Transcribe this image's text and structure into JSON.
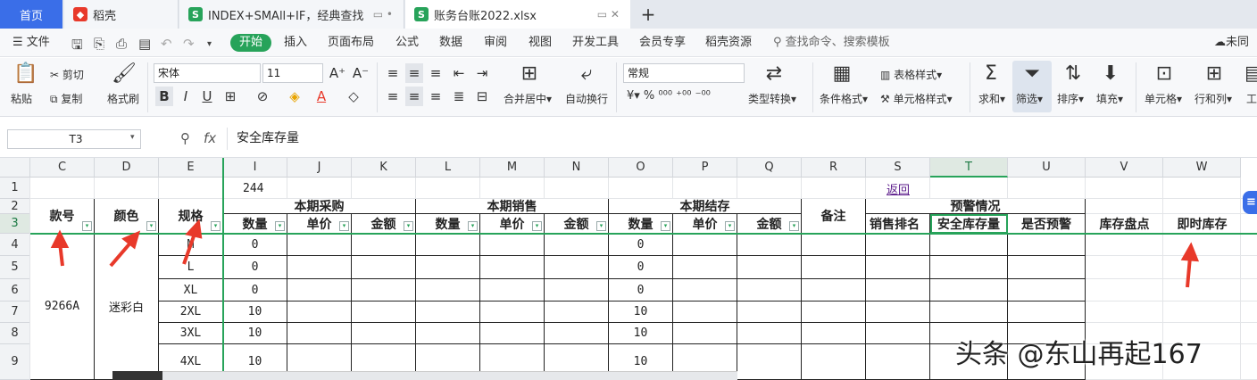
{
  "tabs": {
    "home": "首页",
    "shell": "稻壳",
    "file1": "INDEX+SMAll+IF，经典查找",
    "file2": "账务台账2022.xlsx",
    "add": "+"
  },
  "menu": {
    "file": "文件",
    "start": "开始",
    "insert": "插入",
    "layout": "页面布局",
    "formula": "公式",
    "data": "数据",
    "review": "审阅",
    "view": "视图",
    "dev": "开发工具",
    "vip": "会员专享",
    "resource": "稻壳资源",
    "search": "查找命令、搜索模板",
    "sync": "未同步"
  },
  "ribbon": {
    "paste": "粘贴",
    "cut": "剪切",
    "copy": "复制",
    "format_painter": "格式刷",
    "font_name": "宋体",
    "font_size": "11",
    "number_format": "常规",
    "merge": "合并居中",
    "wrap": "自动换行",
    "type_convert": "类型转换",
    "cond_format": "条件格式",
    "table_style": "表格样式",
    "cell_style": "单元格样式",
    "sum": "求和",
    "filter": "筛选",
    "sort": "排序",
    "fill": "填充",
    "cell": "单元格",
    "rowcol": "行和列",
    "ws": "工"
  },
  "formula_bar": {
    "name_box": "T3",
    "fx": "fx",
    "value": "安全库存量"
  },
  "columns": [
    "C",
    "D",
    "E",
    "I",
    "J",
    "K",
    "L",
    "M",
    "N",
    "O",
    "P",
    "Q",
    "R",
    "S",
    "T",
    "U",
    "V",
    "W"
  ],
  "rows": [
    "1",
    "2",
    "3",
    "4",
    "5",
    "6",
    "7",
    "8",
    "9"
  ],
  "sheet": {
    "i1": "244",
    "s1": "返回",
    "kuanhao": "款号",
    "yanse": "颜色",
    "guige": "规格",
    "purchase": "本期采购",
    "sales": "本期销售",
    "stock": "本期结存",
    "remark": "备注",
    "warning": "预警情况",
    "qty": "数量",
    "price": "单价",
    "amount": "金额",
    "sales_rank": "销售排名",
    "safety": "安全库存量",
    "is_warn": "是否预警",
    "inventory": "库存盘点",
    "realtime": "即时库存",
    "style_no": "9266A",
    "color_val": "迷彩白",
    "sizes": [
      "M",
      "L",
      "XL",
      "2XL",
      "3XL",
      "4XL"
    ],
    "purchase_qty": [
      "0",
      "0",
      "0",
      "10",
      "10",
      "10"
    ],
    "stock_qty": [
      "0",
      "0",
      "0",
      "10",
      "10",
      "10"
    ]
  },
  "watermark": "头条 @东山再起167"
}
